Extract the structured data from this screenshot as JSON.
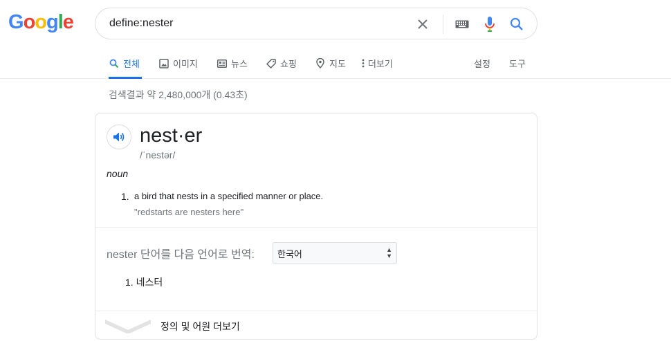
{
  "logo": {
    "letters": [
      "G",
      "o",
      "o",
      "g",
      "l",
      "e"
    ],
    "colors": [
      "#4285f4",
      "#ea4335",
      "#fbbc05",
      "#4285f4",
      "#34a853",
      "#ea4335"
    ]
  },
  "search": {
    "query": "define:nester"
  },
  "tabs": [
    {
      "label": "전체",
      "icon": "search-icon",
      "active": true
    },
    {
      "label": "이미지",
      "icon": "image-icon"
    },
    {
      "label": "뉴스",
      "icon": "news-icon"
    },
    {
      "label": "쇼핑",
      "icon": "tag-icon"
    },
    {
      "label": "지도",
      "icon": "map-pin-icon"
    },
    {
      "label": "더보기",
      "icon": "more-vert-icon"
    }
  ],
  "tools": {
    "settings": "설정",
    "tools": "도구"
  },
  "result_stats": "검색결과 약 2,480,000개 (0.43초)",
  "dictionary": {
    "word": "nest·er",
    "phonetic": "/ˈnestər/",
    "part_of_speech": "noun",
    "definitions": [
      {
        "num": "1.",
        "text": "a bird that nests in a specified manner or place.",
        "example": "\"redstarts are nesters here\""
      }
    ]
  },
  "translate": {
    "label": "nester 단어를 다음 언어로 번역:",
    "selected_language": "한국어",
    "results": [
      {
        "num": "1.",
        "text": "네스터"
      }
    ]
  },
  "more_link": "정의 및 어원 더보기",
  "colors": {
    "accent": "#1a73e8",
    "muted": "#70757a"
  }
}
